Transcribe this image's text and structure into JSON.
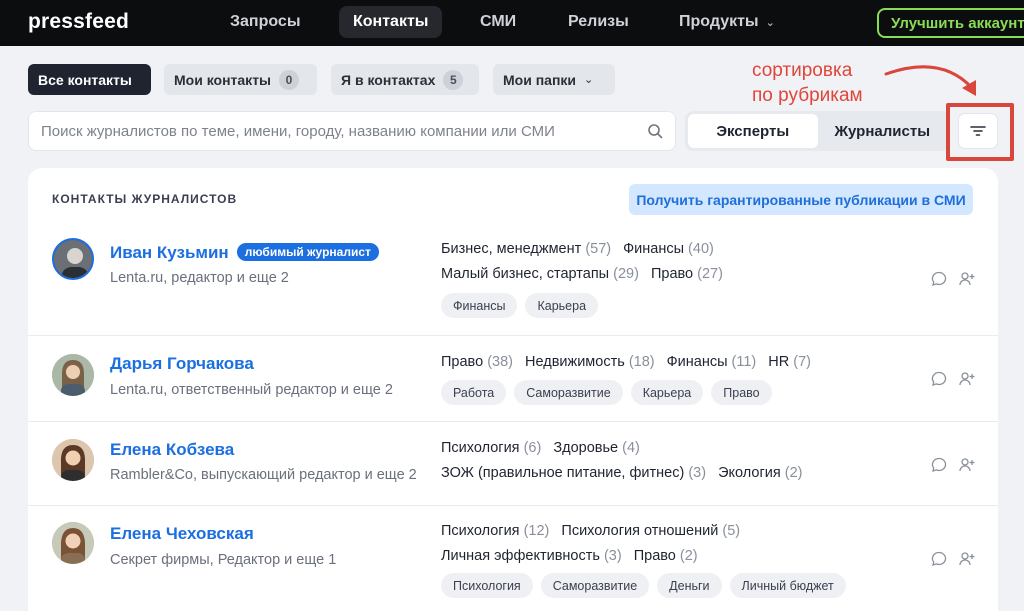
{
  "app": {
    "logo": "pressfeed",
    "nav": [
      {
        "label": "Запросы"
      },
      {
        "label": "Контакты",
        "active": true
      },
      {
        "label": "СМИ"
      },
      {
        "label": "Релизы"
      },
      {
        "label": "Продукты",
        "dropdown": true
      }
    ],
    "upgrade_label": "Улучшить аккаунт"
  },
  "filters": {
    "chips": [
      {
        "label": "Все контакты",
        "active": true
      },
      {
        "label": "Мои контакты",
        "count": "0"
      },
      {
        "label": "Я в контактах",
        "count": "5"
      },
      {
        "label": "Мои папки",
        "dropdown": true
      }
    ]
  },
  "annotation": {
    "line1": "сортировка",
    "line2": "по рубрикам",
    "color": "#e0453a"
  },
  "search": {
    "placeholder": "Поиск журналистов по теме, имени, городу, названию компании или СМИ"
  },
  "toggle": {
    "experts": "Эксперты",
    "journalists": "Журналисты"
  },
  "card": {
    "title": "КОНТАКТЫ ЖУРНАЛИСТОВ",
    "promo_label": "Получить гарантированные публикации в СМИ"
  },
  "contacts": [
    {
      "name": "Иван Кузьмин",
      "badge": "любимый журналист",
      "subtitle": "Lenta.ru, редактор и еще 2",
      "topics_line1": [
        {
          "t": "Бизнес, менеджмент",
          "n": "(57)"
        },
        {
          "t": "Финансы",
          "n": "(40)"
        }
      ],
      "topics_line2": [
        {
          "t": "Малый бизнес, стартапы",
          "n": "(29)"
        },
        {
          "t": "Право",
          "n": "(27)"
        }
      ],
      "tags": [
        "Финансы",
        "Карьера"
      ]
    },
    {
      "name": "Дарья Горчакова",
      "subtitle": "Lenta.ru, ответственный редактор и еще 2",
      "topics_line1": [
        {
          "t": "Право",
          "n": "(38)"
        },
        {
          "t": "Недвижимость",
          "n": "(18)"
        },
        {
          "t": "Финансы",
          "n": "(11)"
        },
        {
          "t": "HR",
          "n": "(7)"
        }
      ],
      "tags": [
        "Работа",
        "Саморазвитие",
        "Карьера",
        "Право"
      ]
    },
    {
      "name": "Елена Кобзева",
      "subtitle": "Rambler&Co, выпускающий редактор и еще 2",
      "topics_line1": [
        {
          "t": "Психология",
          "n": "(6)"
        },
        {
          "t": "Здоровье",
          "n": "(4)"
        }
      ],
      "topics_line2": [
        {
          "t": "ЗОЖ (правильное питание, фитнес)",
          "n": "(3)"
        },
        {
          "t": "Экология",
          "n": "(2)"
        }
      ]
    },
    {
      "name": "Елена Чеховская",
      "subtitle": "Секрет фирмы, Редактор и еще 1",
      "topics_line1": [
        {
          "t": "Психология",
          "n": "(12)"
        },
        {
          "t": "Психология отношений",
          "n": "(5)"
        }
      ],
      "topics_line2": [
        {
          "t": "Личная эффективность",
          "n": "(3)"
        },
        {
          "t": "Право",
          "n": "(2)"
        }
      ],
      "tags": [
        "Психология",
        "Саморазвитие",
        "Деньги",
        "Личный бюджет"
      ]
    }
  ]
}
